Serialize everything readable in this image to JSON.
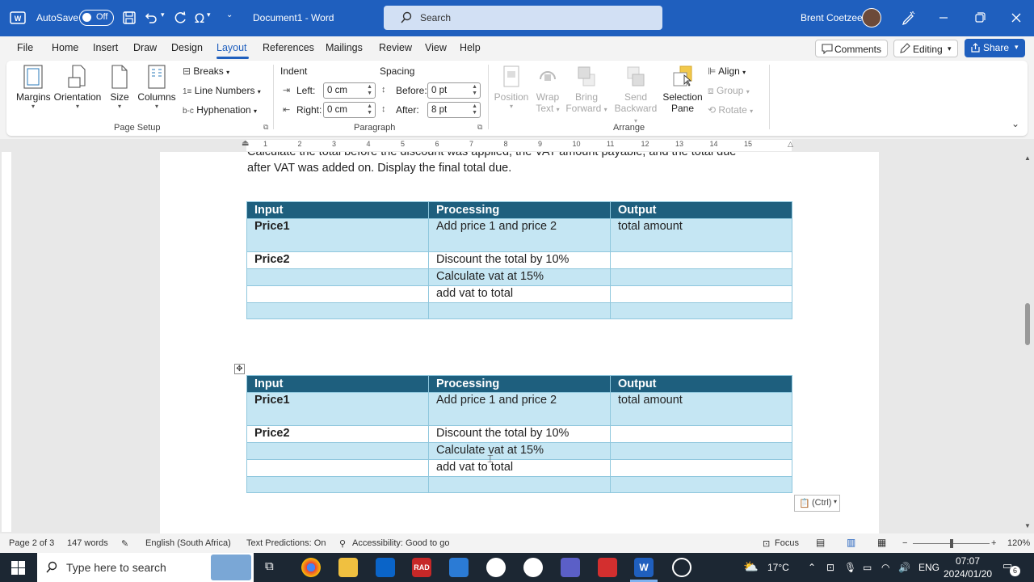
{
  "titlebar": {
    "autosave_label": "AutoSave",
    "autosave_state": "Off",
    "doc_title": "Document1  -  Word",
    "search_placeholder": "Search",
    "user_name": "Brent Coetzee"
  },
  "menu": {
    "items": [
      "File",
      "Home",
      "Insert",
      "Draw",
      "Design",
      "Layout",
      "References",
      "Mailings",
      "Review",
      "View",
      "Help"
    ],
    "active": "Layout",
    "comments_label": "Comments",
    "editing_label": "Editing",
    "share_label": "Share"
  },
  "ribbon": {
    "page_setup": {
      "margins": "Margins",
      "orientation": "Orientation",
      "size": "Size",
      "columns": "Columns",
      "breaks": "Breaks",
      "line_numbers": "Line Numbers",
      "hyphenation": "Hyphenation",
      "group_label": "Page Setup"
    },
    "paragraph": {
      "indent_label": "Indent",
      "left_label": "Left:",
      "left_value": "0 cm",
      "right_label": "Right:",
      "right_value": "0 cm",
      "spacing_label": "Spacing",
      "before_label": "Before:",
      "before_value": "0 pt",
      "after_label": "After:",
      "after_value": "8 pt",
      "group_label": "Paragraph"
    },
    "arrange": {
      "position": "Position",
      "wrap_text_1": "Wrap",
      "wrap_text_2": "Text",
      "bring_forward_1": "Bring",
      "bring_forward_2": "Forward",
      "send_backward_1": "Send",
      "send_backward_2": "Backward",
      "selection_pane_1": "Selection",
      "selection_pane_2": "Pane",
      "align": "Align",
      "group": "Group",
      "rotate": "Rotate",
      "group_label": "Arrange"
    }
  },
  "ruler": {
    "numbers": [
      "1",
      "2",
      "3",
      "4",
      "5",
      "6",
      "7",
      "8",
      "9",
      "10",
      "11",
      "12",
      "13",
      "14",
      "15"
    ]
  },
  "document": {
    "paragraph_line1": "Calculate the total before the discount was applied, the VAT amount payable, and the total due",
    "paragraph_line2": "after VAT was added on. Display the final total due.",
    "table1": {
      "headers": [
        "Input",
        "Processing",
        "Output"
      ],
      "rows": [
        [
          "Price1",
          "Add price 1 and price 2",
          "total amount"
        ],
        [
          "Price2",
          "Discount the total by 10%",
          ""
        ],
        [
          "",
          "Calculate vat at 15%",
          ""
        ],
        [
          "",
          "add vat to total",
          ""
        ],
        [
          "",
          "",
          ""
        ]
      ]
    },
    "table2": {
      "headers": [
        "Input",
        "Processing",
        "Output"
      ],
      "rows": [
        [
          "Price1",
          "Add price 1 and price 2",
          "total amount"
        ],
        [
          "Price2",
          "Discount the total by 10%",
          ""
        ],
        [
          "",
          "Calculate vat at 15%",
          ""
        ],
        [
          "",
          "add vat to total",
          ""
        ],
        [
          "",
          "",
          ""
        ]
      ]
    },
    "paste_options_label": "(Ctrl)"
  },
  "statusbar": {
    "page": "Page 2 of 3",
    "words": "147 words",
    "language": "English (South Africa)",
    "text_predictions": "Text Predictions: On",
    "accessibility": "Accessibility: Good to go",
    "focus": "Focus",
    "zoom": "120%"
  },
  "taskbar": {
    "search_placeholder": "Type here to search",
    "temperature": "17°C",
    "language": "ENG",
    "time": "07:07",
    "date": "2024/01/20",
    "notification_count": "6"
  },
  "colors": {
    "word_blue": "#1f5fbe",
    "table_header": "#1e5f7e",
    "table_band": "#c5e6f3"
  }
}
